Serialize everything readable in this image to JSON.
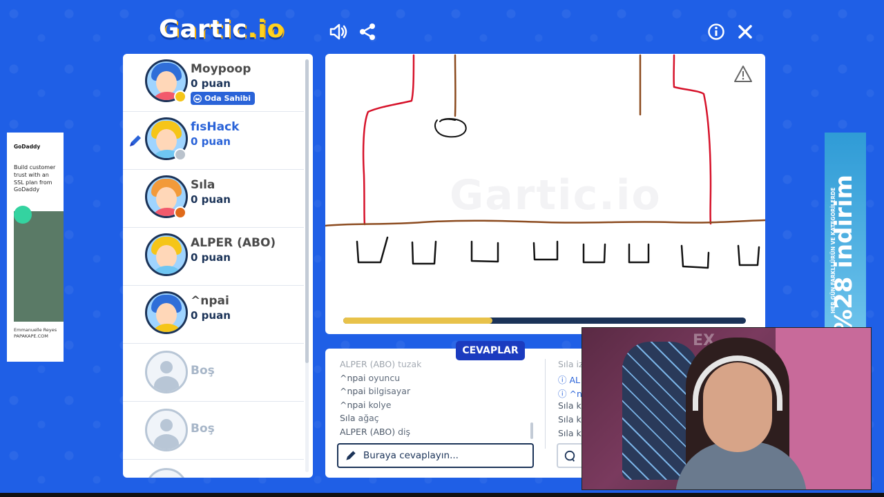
{
  "header": {
    "logo_main": "Gartic",
    "logo_suffix": ".io",
    "icons": [
      "speaker-icon",
      "share-icon",
      "info-icon",
      "close-icon"
    ]
  },
  "players": [
    {
      "name": "Moypoop",
      "score": "0 puan",
      "badge": "Oda Sahibi",
      "status_color": "#f5c518",
      "hair_color": "#2f6ed8",
      "shirt_color": "#f25a6c",
      "drawing": false
    },
    {
      "name": "fısHack",
      "score": "0 puan",
      "badge": "",
      "status_color": "#b9c2cc",
      "hair_color": "#f5c518",
      "shirt_color": "#6fc6f2",
      "drawing": true
    },
    {
      "name": "Sıla",
      "score": "0 puan",
      "badge": "",
      "status_color": "#e06a1a",
      "hair_color": "#f29a3a",
      "shirt_color": "#f25a6c",
      "drawing": false
    },
    {
      "name": "ALPER (ABO)",
      "score": "0 puan",
      "badge": "",
      "status_color": "",
      "hair_color": "#f5c518",
      "shirt_color": "#6fc6f2",
      "drawing": false
    },
    {
      "name": "^npai",
      "score": "0 puan",
      "badge": "",
      "status_color": "",
      "hair_color": "#2f6ed8",
      "shirt_color": "#f5c518",
      "drawing": false
    }
  ],
  "empty_slots": [
    {
      "label": "Boş"
    },
    {
      "label": "Boş"
    }
  ],
  "canvas": {
    "watermark": "Gartic.io",
    "timer_progress": 0.37,
    "timer_color": "#e8c24a"
  },
  "answers": {
    "tab_label": "CEVAPLAR",
    "rows": [
      {
        "nick": "ALPER (ABO)",
        "word": "tuzak"
      },
      {
        "nick": "^npai",
        "word": "oyuncu"
      },
      {
        "nick": "^npai",
        "word": "bilgisayar"
      },
      {
        "nick": "^npai",
        "word": "kolye"
      },
      {
        "nick": "Sıla",
        "word": "ağaç"
      },
      {
        "nick": "ALPER (ABO)",
        "word": "diş"
      }
    ],
    "input_placeholder": "Buraya cevaplayın..."
  },
  "chat": {
    "rows": [
      {
        "text": "Sıla iz",
        "system": false
      },
      {
        "text": "ⓘ AL",
        "system": true
      },
      {
        "text": "ⓘ ^n",
        "system": true
      },
      {
        "text": "Sıla k",
        "system": false
      },
      {
        "text": "Sıla k",
        "system": false
      },
      {
        "text": "Sıla k",
        "system": false
      }
    ]
  },
  "ad_left": {
    "brand": "GoDaddy",
    "copy": "Build customer trust with an SSL plan from GoDaddy",
    "credit_name": "Emmanuelle Reyes",
    "credit_site": "PAPAKAPE.COM"
  },
  "ad_right": {
    "headline": "%28 indirim",
    "sub": "HER GÜN FARKLI ÜRÜN VE KATEGORİLERDE"
  },
  "webcam": {
    "overlay_text": "EX"
  }
}
